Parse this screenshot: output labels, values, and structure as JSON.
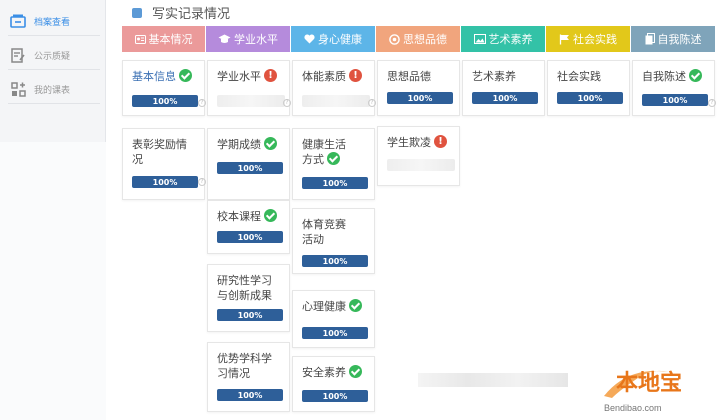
{
  "sidebar": {
    "items": [
      {
        "label": "档案查看",
        "icon": "archive-icon",
        "active": true
      },
      {
        "label": "公示质疑",
        "icon": "edit-doc-icon",
        "active": false
      },
      {
        "label": "我的课表",
        "icon": "schedule-icon",
        "active": false
      }
    ]
  },
  "section": {
    "title": "写实记录情况"
  },
  "tabs": [
    {
      "label": "基本情况",
      "icon": "id-card-icon",
      "color": "#eb9a9a"
    },
    {
      "label": "学业水平",
      "icon": "graduation-cap-icon",
      "color": "#b58bdc"
    },
    {
      "label": "身心健康",
      "icon": "heart-icon",
      "color": "#5db5e8"
    },
    {
      "label": "思想品德",
      "icon": "flower-icon",
      "color": "#f1a57d"
    },
    {
      "label": "艺术素养",
      "icon": "picture-icon",
      "color": "#33c2a7"
    },
    {
      "label": "社会实践",
      "icon": "flag-icon",
      "color": "#e2c81a"
    },
    {
      "label": "自我陈述",
      "icon": "document-icon",
      "color": "#7fa4ba"
    }
  ],
  "cards": {
    "basic_info": {
      "title": "基本信息",
      "status": "ok",
      "progress": "100%"
    },
    "awards": {
      "title": "表彰奖励情况",
      "progress": "100%"
    },
    "academic_level": {
      "title": "学业水平",
      "status": "warn"
    },
    "term_grades": {
      "title": "学期成绩",
      "status": "ok",
      "progress": "100%"
    },
    "school_courses": {
      "title": "校本课程",
      "status": "ok",
      "progress": "100%"
    },
    "research": {
      "title": "研究性学习与创新成果",
      "progress": "100%"
    },
    "advantage": {
      "title": "优势学科学习情况",
      "progress": "100%"
    },
    "fitness": {
      "title": "体能素质",
      "status": "warn"
    },
    "lifestyle": {
      "title": "健康生活方式",
      "status": "ok",
      "progress": "100%"
    },
    "sports": {
      "title": "体育竞赛活动",
      "progress": "100%"
    },
    "mental": {
      "title": "心理健康",
      "status": "ok",
      "progress": "100%"
    },
    "safety": {
      "title": "安全素养",
      "status": "ok",
      "progress": "100%"
    },
    "moral": {
      "title": "思想品德",
      "progress": "100%"
    },
    "bullying": {
      "title": "学生欺凌",
      "status": "warn"
    },
    "arts": {
      "title": "艺术素养",
      "progress": "100%"
    },
    "practice": {
      "title": "社会实践",
      "progress": "100%"
    },
    "statement": {
      "title": "自我陈述",
      "status": "ok",
      "progress": "100%"
    }
  },
  "watermark": {
    "brand": "本地宝",
    "url": "Bendibao.com"
  }
}
